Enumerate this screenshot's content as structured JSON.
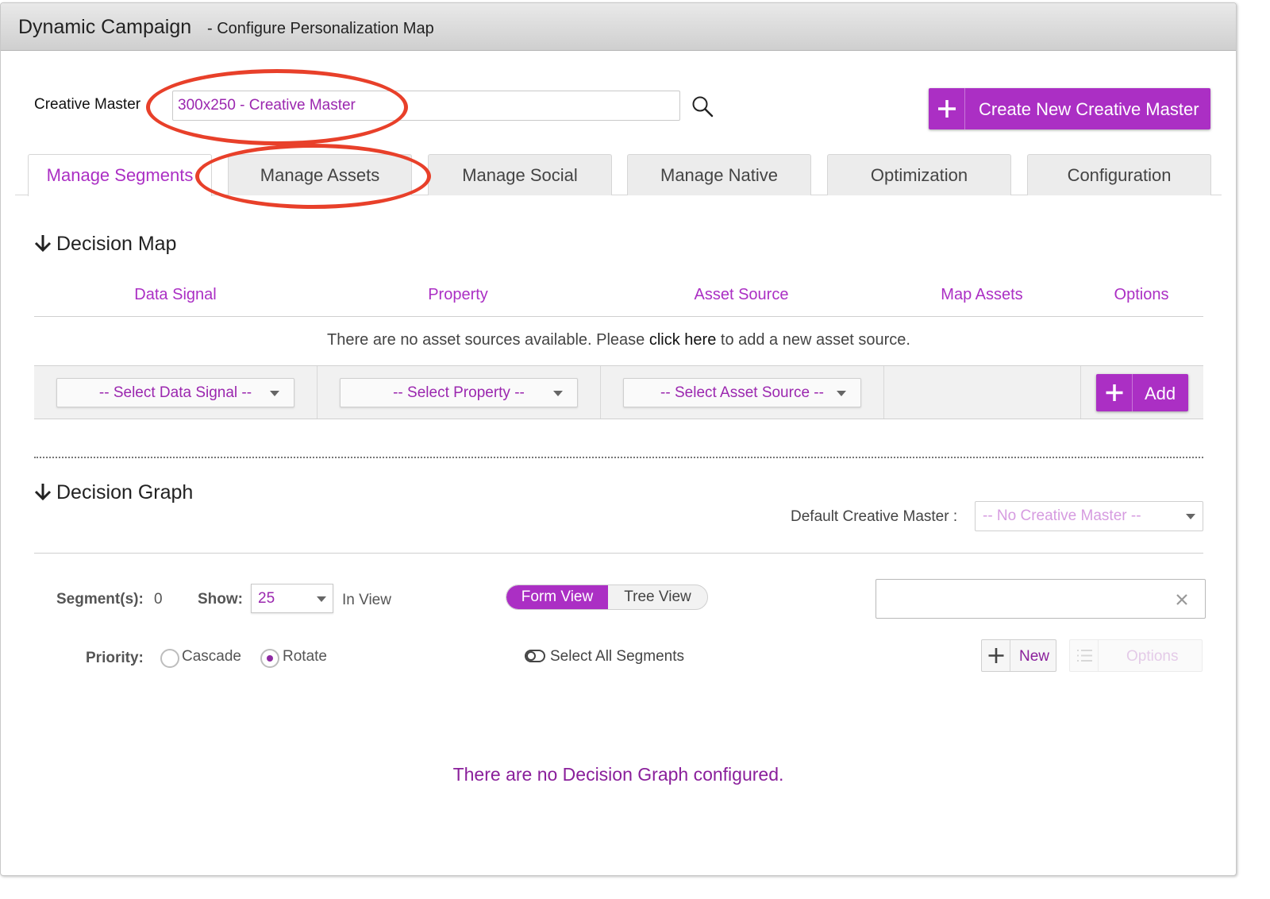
{
  "window": {
    "title": "Dynamic Campaign",
    "subtitle": "- Configure Personalization Map"
  },
  "creative_master": {
    "label": "Creative Master",
    "value": "300x250 - Creative Master",
    "create_button": "Create New Creative Master"
  },
  "tabs": [
    {
      "label": "Manage Segments",
      "active": true
    },
    {
      "label": "Manage Assets",
      "active": false
    },
    {
      "label": "Manage Social",
      "active": false
    },
    {
      "label": "Manage Native",
      "active": false
    },
    {
      "label": "Optimization",
      "active": false
    },
    {
      "label": "Configuration",
      "active": false
    }
  ],
  "decision_map": {
    "title": "Decision Map",
    "columns": [
      "Data Signal",
      "Property",
      "Asset Source",
      "Map Assets",
      "Options"
    ],
    "empty_message_before": "There are no asset sources available. Please",
    "empty_message_link": "click here",
    "empty_message_after": "to add a new asset source.",
    "selects": {
      "data_signal": "-- Select Data Signal --",
      "property": "-- Select Property --",
      "asset_source": "-- Select Asset Source --"
    },
    "add_button": "Add"
  },
  "decision_graph": {
    "title": "Decision Graph",
    "default_label": "Default Creative Master :",
    "default_value": "-- No Creative Master --",
    "segments_label": "Segment(s):",
    "segments_count": "0",
    "show_label": "Show:",
    "show_value": "25",
    "in_view": "In View",
    "form_view": "Form View",
    "tree_view": "Tree View",
    "priority_label": "Priority:",
    "cascade": "Cascade",
    "rotate": "Rotate",
    "select_all": "Select All Segments",
    "new_button": "New",
    "options_button": "Options",
    "empty_message": "There are no Decision Graph configured."
  },
  "colors": {
    "accent": "#ab2fc4",
    "annotation": "#e8402a"
  },
  "icons": [
    "search-icon",
    "plus-icon",
    "arrow-down-icon",
    "caret-down-icon",
    "close-icon",
    "toggle-icon",
    "list-icon"
  ]
}
